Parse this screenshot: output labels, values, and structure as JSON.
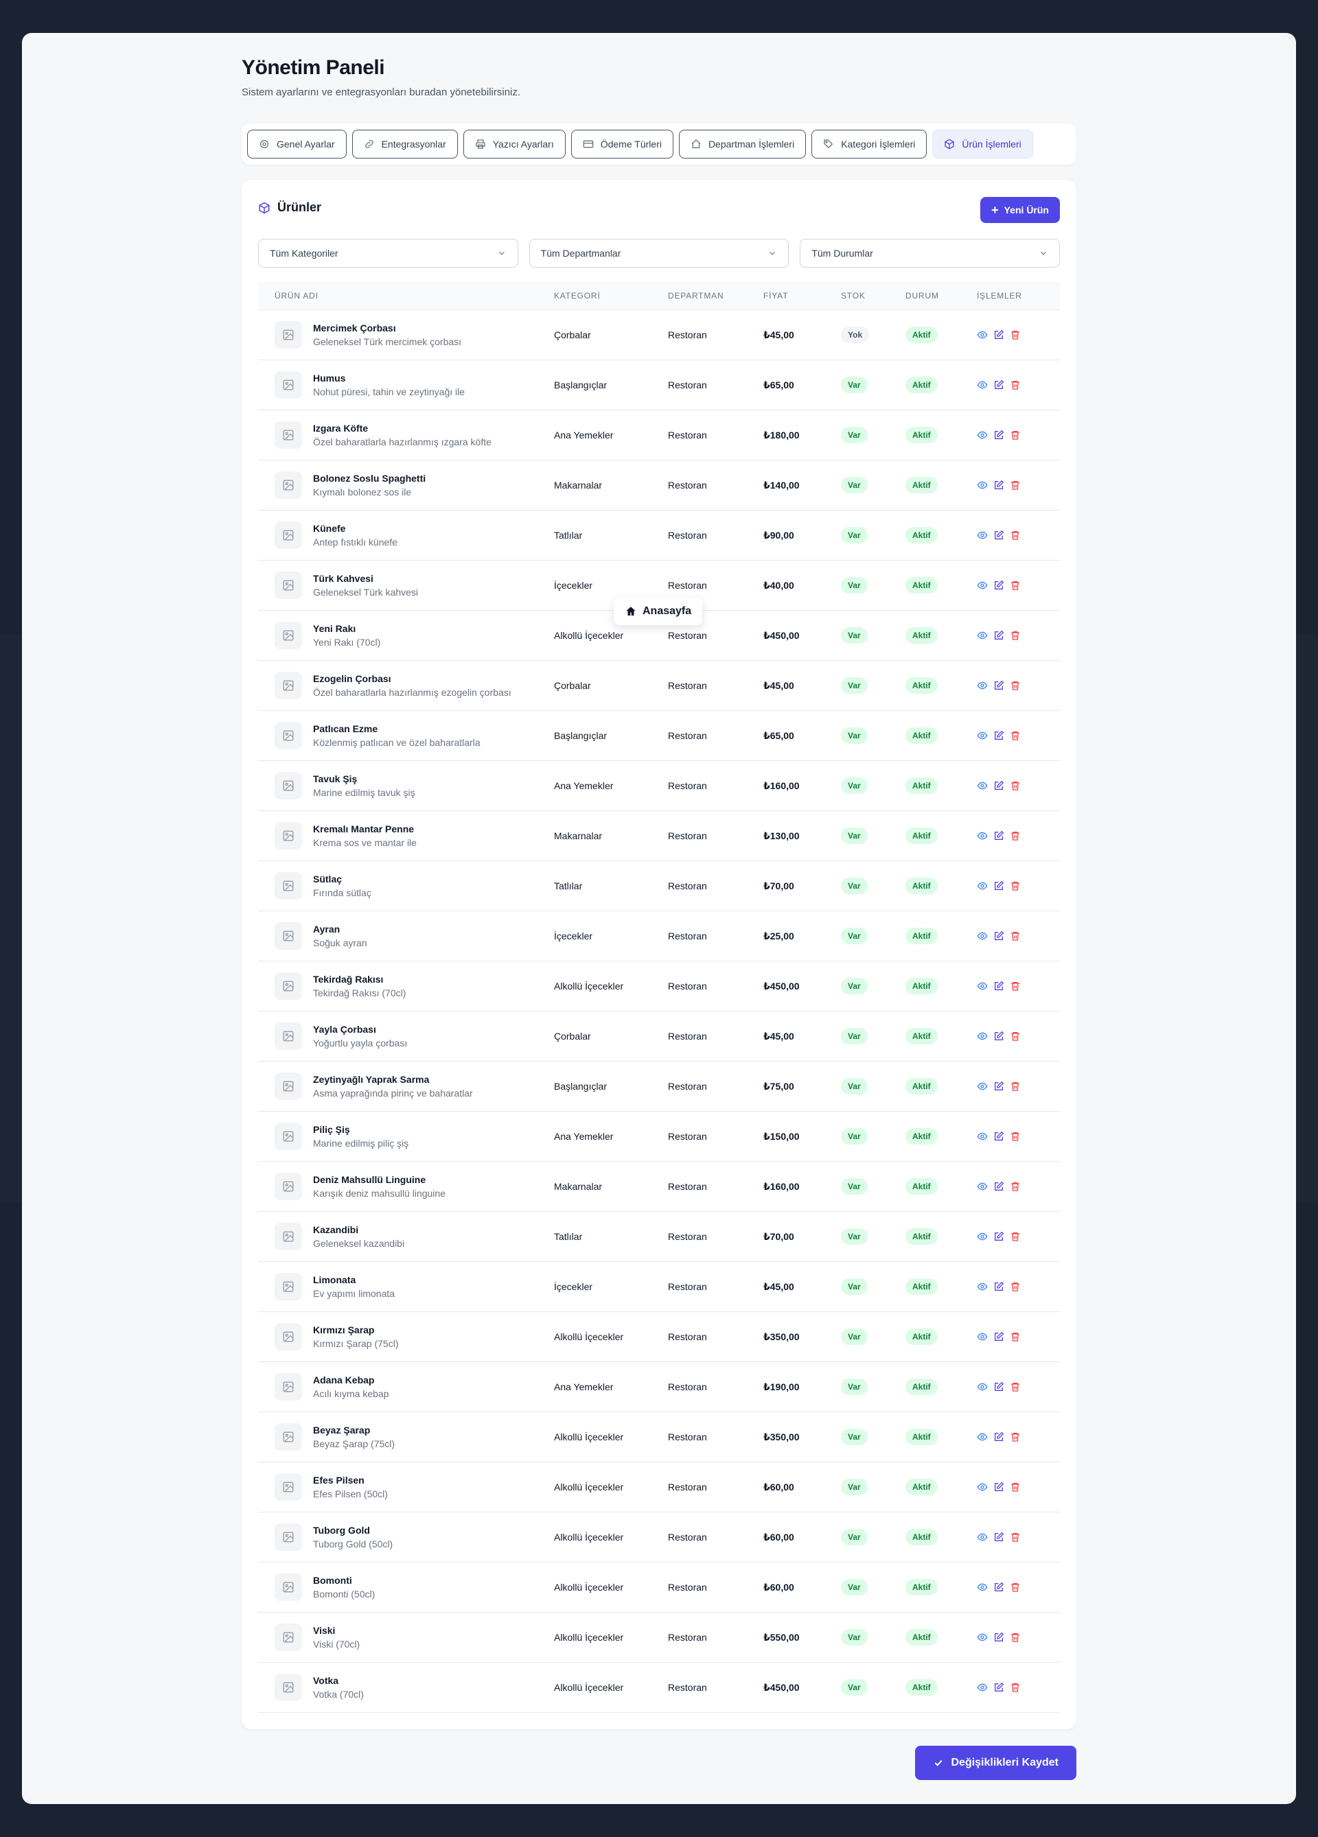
{
  "header": {
    "title": "Yönetim Paneli",
    "subtitle": "Sistem ayarlarını ve entegrasyonları buradan yönetebilirsiniz."
  },
  "tabs": [
    {
      "label": "Genel Ayarlar",
      "icon": "gear-icon"
    },
    {
      "label": "Entegrasyonlar",
      "icon": "link-icon"
    },
    {
      "label": "Yazıcı Ayarları",
      "icon": "printer-icon"
    },
    {
      "label": "Ödeme Türleri",
      "icon": "credit-card-icon"
    },
    {
      "label": "Departman İşlemleri",
      "icon": "home-icon"
    },
    {
      "label": "Kategori İşlemleri",
      "icon": "tag-icon"
    },
    {
      "label": "Ürün İşlemleri",
      "icon": "cube-icon",
      "active": true
    }
  ],
  "card": {
    "title": "Ürünler",
    "new_button": "Yeni Ürün"
  },
  "filters": {
    "category": "Tüm Kategoriler",
    "department": "Tüm Departmanlar",
    "status": "Tüm Durumlar"
  },
  "table": {
    "headers": [
      "ÜRÜN ADI",
      "KATEGORİ",
      "DEPARTMAN",
      "FİYAT",
      "STOK",
      "DURUM",
      "İŞLEMLER"
    ],
    "rows": [
      {
        "name": "Mercimek Çorbası",
        "desc": "Geleneksel Türk mercimek çorbası",
        "category": "Çorbalar",
        "department": "Restoran",
        "price": "₺45,00",
        "stock": "Yok",
        "status": "Aktif"
      },
      {
        "name": "Humus",
        "desc": "Nohut püresi, tahin ve zeytinyağı ile",
        "category": "Başlangıçlar",
        "department": "Restoran",
        "price": "₺65,00",
        "stock": "Var",
        "status": "Aktif"
      },
      {
        "name": "Izgara Köfte",
        "desc": "Özel baharatlarla hazırlanmış ızgara köfte",
        "category": "Ana Yemekler",
        "department": "Restoran",
        "price": "₺180,00",
        "stock": "Var",
        "status": "Aktif"
      },
      {
        "name": "Bolonez Soslu Spaghetti",
        "desc": "Kıymalı bolonez sos ile",
        "category": "Makarnalar",
        "department": "Restoran",
        "price": "₺140,00",
        "stock": "Var",
        "status": "Aktif"
      },
      {
        "name": "Künefe",
        "desc": "Antep fıstıklı künefe",
        "category": "Tatlılar",
        "department": "Restoran",
        "price": "₺90,00",
        "stock": "Var",
        "status": "Aktif"
      },
      {
        "name": "Türk Kahvesi",
        "desc": "Geleneksel Türk kahvesi",
        "category": "İçecekler",
        "department": "Restoran",
        "price": "₺40,00",
        "stock": "Var",
        "status": "Aktif"
      },
      {
        "name": "Yeni Rakı",
        "desc": "Yeni Rakı (70cl)",
        "category": "Alkollü İçecekler",
        "department": "Restoran",
        "price": "₺450,00",
        "stock": "Var",
        "status": "Aktif"
      },
      {
        "name": "Ezogelin Çorbası",
        "desc": "Özel baharatlarla hazırlanmış ezogelin çorbası",
        "category": "Çorbalar",
        "department": "Restoran",
        "price": "₺45,00",
        "stock": "Var",
        "status": "Aktif"
      },
      {
        "name": "Patlıcan Ezme",
        "desc": "Közlenmiş patlıcan ve özel baharatlarla",
        "category": "Başlangıçlar",
        "department": "Restoran",
        "price": "₺65,00",
        "stock": "Var",
        "status": "Aktif"
      },
      {
        "name": "Tavuk Şiş",
        "desc": "Marine edilmiş tavuk şiş",
        "category": "Ana Yemekler",
        "department": "Restoran",
        "price": "₺160,00",
        "stock": "Var",
        "status": "Aktif"
      },
      {
        "name": "Kremalı Mantar Penne",
        "desc": "Krema sos ve mantar ile",
        "category": "Makarnalar",
        "department": "Restoran",
        "price": "₺130,00",
        "stock": "Var",
        "status": "Aktif"
      },
      {
        "name": "Sütlaç",
        "desc": "Fırında sütlaç",
        "category": "Tatlılar",
        "department": "Restoran",
        "price": "₺70,00",
        "stock": "Var",
        "status": "Aktif"
      },
      {
        "name": "Ayran",
        "desc": "Soğuk ayran",
        "category": "İçecekler",
        "department": "Restoran",
        "price": "₺25,00",
        "stock": "Var",
        "status": "Aktif"
      },
      {
        "name": "Tekirdağ Rakısı",
        "desc": "Tekirdağ Rakısı (70cl)",
        "category": "Alkollü İçecekler",
        "department": "Restoran",
        "price": "₺450,00",
        "stock": "Var",
        "status": "Aktif"
      },
      {
        "name": "Yayla Çorbası",
        "desc": "Yoğurtlu yayla çorbası",
        "category": "Çorbalar",
        "department": "Restoran",
        "price": "₺45,00",
        "stock": "Var",
        "status": "Aktif"
      },
      {
        "name": "Zeytinyağlı Yaprak Sarma",
        "desc": "Asma yaprağında pirinç ve baharatlar",
        "category": "Başlangıçlar",
        "department": "Restoran",
        "price": "₺75,00",
        "stock": "Var",
        "status": "Aktif"
      },
      {
        "name": "Piliç Şiş",
        "desc": "Marine edilmiş piliç şiş",
        "category": "Ana Yemekler",
        "department": "Restoran",
        "price": "₺150,00",
        "stock": "Var",
        "status": "Aktif"
      },
      {
        "name": "Deniz Mahsullü Linguine",
        "desc": "Karışık deniz mahsullü linguine",
        "category": "Makarnalar",
        "department": "Restoran",
        "price": "₺160,00",
        "stock": "Var",
        "status": "Aktif"
      },
      {
        "name": "Kazandibi",
        "desc": "Geleneksel kazandibi",
        "category": "Tatlılar",
        "department": "Restoran",
        "price": "₺70,00",
        "stock": "Var",
        "status": "Aktif"
      },
      {
        "name": "Limonata",
        "desc": "Ev yapımı limonata",
        "category": "İçecekler",
        "department": "Restoran",
        "price": "₺45,00",
        "stock": "Var",
        "status": "Aktif"
      },
      {
        "name": "Kırmızı Şarap",
        "desc": "Kırmızı Şarap (75cl)",
        "category": "Alkollü İçecekler",
        "department": "Restoran",
        "price": "₺350,00",
        "stock": "Var",
        "status": "Aktif"
      },
      {
        "name": "Adana Kebap",
        "desc": "Acılı kıyma kebap",
        "category": "Ana Yemekler",
        "department": "Restoran",
        "price": "₺190,00",
        "stock": "Var",
        "status": "Aktif"
      },
      {
        "name": "Beyaz Şarap",
        "desc": "Beyaz Şarap (75cl)",
        "category": "Alkollü İçecekler",
        "department": "Restoran",
        "price": "₺350,00",
        "stock": "Var",
        "status": "Aktif"
      },
      {
        "name": "Efes Pilsen",
        "desc": "Efes Pilsen (50cl)",
        "category": "Alkollü İçecekler",
        "department": "Restoran",
        "price": "₺60,00",
        "stock": "Var",
        "status": "Aktif"
      },
      {
        "name": "Tuborg Gold",
        "desc": "Tuborg Gold (50cl)",
        "category": "Alkollü İçecekler",
        "department": "Restoran",
        "price": "₺60,00",
        "stock": "Var",
        "status": "Aktif"
      },
      {
        "name": "Bomonti",
        "desc": "Bomonti (50cl)",
        "category": "Alkollü İçecekler",
        "department": "Restoran",
        "price": "₺60,00",
        "stock": "Var",
        "status": "Aktif"
      },
      {
        "name": "Viski",
        "desc": "Viski (70cl)",
        "category": "Alkollü İçecekler",
        "department": "Restoran",
        "price": "₺550,00",
        "stock": "Var",
        "status": "Aktif"
      },
      {
        "name": "Votka",
        "desc": "Votka (70cl)",
        "category": "Alkollü İçecekler",
        "department": "Restoran",
        "price": "₺450,00",
        "stock": "Var",
        "status": "Aktif"
      }
    ]
  },
  "tooltip": {
    "label": "Anasayfa",
    "icon": "home-icon"
  },
  "footer": {
    "save_button": "Değişiklikleri Kaydet"
  },
  "colors": {
    "accent": "#4f46e5",
    "background": "#1b2332",
    "success_bg": "#dcfce7",
    "success_text": "#15803d",
    "view_icon": "#3b82f6",
    "edit_icon": "#4f46e5",
    "delete_icon": "#ef4444"
  }
}
